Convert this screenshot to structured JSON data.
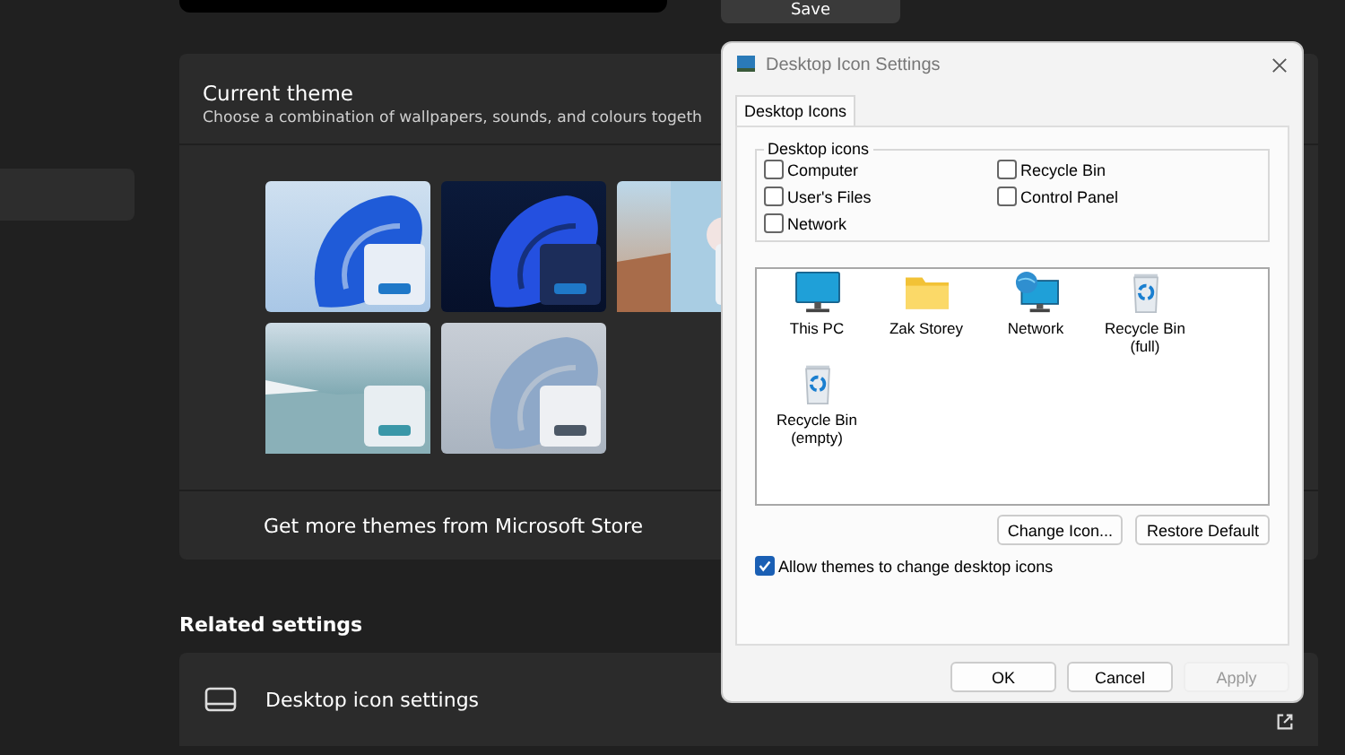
{
  "top": {
    "save_button": "Save"
  },
  "sidebar": {
    "items": [
      {
        "selected": true
      }
    ]
  },
  "current_theme": {
    "title": "Current theme",
    "subtitle": "Choose a combination of wallpapers, sounds, and colours togeth",
    "themes": [
      {
        "kind": "light-bloom"
      },
      {
        "kind": "dark-bloom"
      },
      {
        "kind": "flowers"
      },
      {
        "kind": "lake"
      },
      {
        "kind": "glow"
      }
    ],
    "store_link": "Get more themes from Microsoft Store"
  },
  "related": {
    "heading": "Related settings",
    "items": [
      {
        "label": "Desktop icon settings"
      }
    ]
  },
  "dialog": {
    "title": "Desktop Icon Settings",
    "tabs": [
      {
        "label": "Desktop Icons",
        "selected": true
      }
    ],
    "group_label": "Desktop icons",
    "checkboxes": [
      {
        "label": "Computer",
        "checked": false
      },
      {
        "label": "Recycle Bin",
        "checked": false
      },
      {
        "label": "User's Files",
        "checked": false
      },
      {
        "label": "Control Panel",
        "checked": false
      },
      {
        "label": "Network",
        "checked": false
      }
    ],
    "icons": [
      {
        "label": "This PC",
        "kind": "monitor"
      },
      {
        "label": "Zak Storey",
        "kind": "folder"
      },
      {
        "label": "Network",
        "kind": "network"
      },
      {
        "label": "Recycle Bin (full)",
        "kind": "bin"
      },
      {
        "label": "Recycle Bin (empty)",
        "kind": "bin"
      }
    ],
    "buttons": [
      "Change Icon...",
      "Restore Default"
    ],
    "allow_themes": {
      "label": "Allow themes to change desktop icons",
      "checked": true
    },
    "footer_buttons": [
      {
        "label": "OK",
        "disabled": false
      },
      {
        "label": "Cancel",
        "disabled": false
      },
      {
        "label": "Apply",
        "disabled": true
      }
    ]
  }
}
